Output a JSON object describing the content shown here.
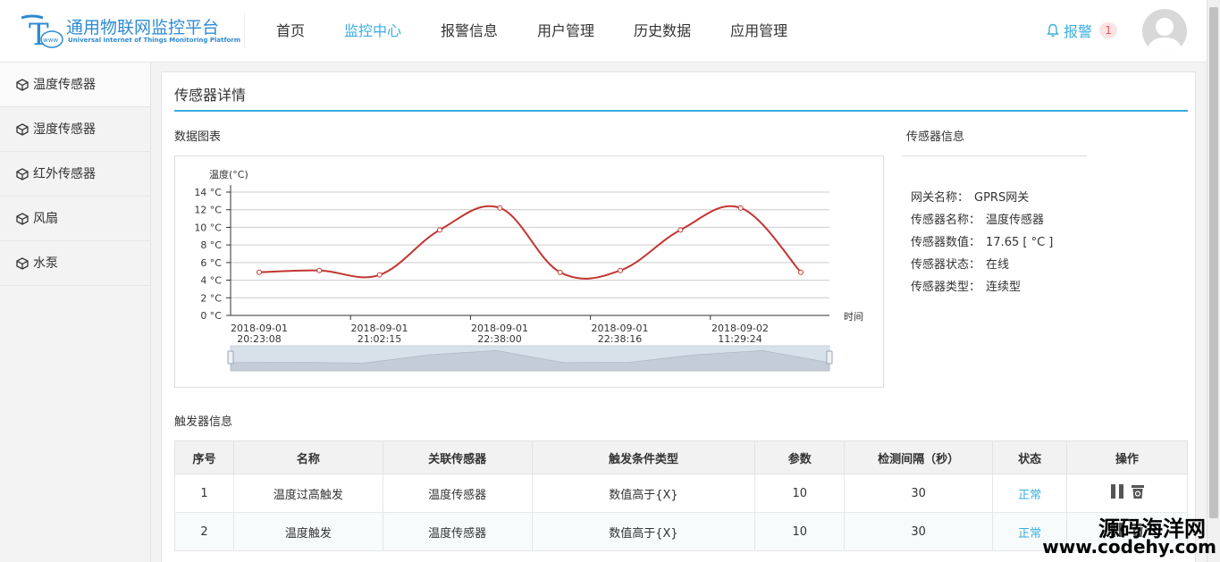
{
  "header": {
    "logo_title": "通用物联网监控平台",
    "logo_sub": "Universal Internet of Things Monitoring Platform",
    "logo_letter": "T",
    "logo_mark_text": "www",
    "nav": [
      {
        "label": "首页",
        "active": false
      },
      {
        "label": "监控中心",
        "active": true
      },
      {
        "label": "报警信息",
        "active": false
      },
      {
        "label": "用户管理",
        "active": false
      },
      {
        "label": "历史数据",
        "active": false
      },
      {
        "label": "应用管理",
        "active": false
      }
    ],
    "alarm_label": "报警",
    "alarm_count": "1"
  },
  "sidebar": {
    "items": [
      {
        "label": "温度传感器",
        "active": true
      },
      {
        "label": "湿度传感器",
        "active": false
      },
      {
        "label": "红外传感器",
        "active": false
      },
      {
        "label": "风扇",
        "active": false
      },
      {
        "label": "水泵",
        "active": false
      }
    ]
  },
  "panel": {
    "title": "传感器详情",
    "chart_section": "数据图表",
    "info_section": "传感器信息",
    "trigger_section": "触发器信息"
  },
  "info": {
    "rows": [
      {
        "label": "网关名称：",
        "value": "GPRS网关"
      },
      {
        "label": "传感器名称：",
        "value": "温度传感器"
      },
      {
        "label": "传感器数值：",
        "value": "17.65 [ °C ]"
      },
      {
        "label": "传感器状态：",
        "value": "在线"
      },
      {
        "label": "传感器类型：",
        "value": "连续型"
      }
    ]
  },
  "chart_data": {
    "type": "line",
    "ylabel": "温度(°C)",
    "xlabel": "时间",
    "ylim": [
      0,
      14
    ],
    "yticks": [
      "0 °C",
      "2 °C",
      "4 °C",
      "6 °C",
      "8 °C",
      "10 °C",
      "12 °C",
      "14 °C"
    ],
    "x_labels": [
      {
        "date": "2018-09-01",
        "time": "20:23:08"
      },
      {
        "date": "2018-09-01",
        "time": "21:02:15"
      },
      {
        "date": "2018-09-01",
        "time": "22:38:00"
      },
      {
        "date": "2018-09-01",
        "time": "22:38:16"
      },
      {
        "date": "2018-09-02",
        "time": "11:29:24"
      }
    ],
    "series": [
      {
        "values": [
          4.9,
          5.1,
          4.6,
          9.7,
          12.2,
          4.9,
          5.1,
          9.7,
          12.2,
          4.9
        ]
      }
    ],
    "grid": true,
    "color": "#c23531"
  },
  "table": {
    "columns": [
      "序号",
      "名称",
      "关联传感器",
      "触发条件类型",
      "参数",
      "检测间隔（秒）",
      "状态",
      "操作"
    ],
    "rows": [
      {
        "no": "1",
        "name": "温度过高触发",
        "sensor": "温度传感器",
        "cond": "数值高于{X}",
        "param": "10",
        "interval": "30",
        "status": "正常"
      },
      {
        "no": "2",
        "name": "温度触发",
        "sensor": "温度传感器",
        "cond": "数值高于{X}",
        "param": "10",
        "interval": "30",
        "status": "正常"
      }
    ]
  },
  "watermark": {
    "line1": "源码海洋网",
    "line2": "www.codehy.com"
  }
}
